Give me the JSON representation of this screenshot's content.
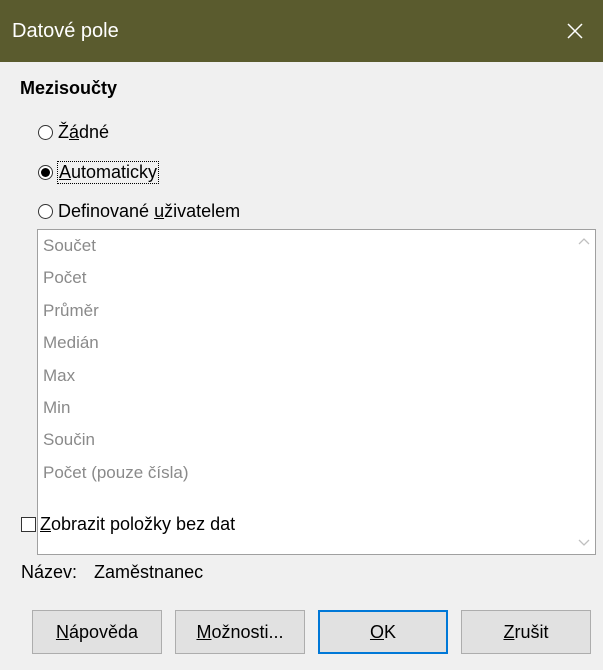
{
  "window": {
    "title": "Datové pole"
  },
  "subtotals": {
    "heading": "Mezisoučty",
    "options": {
      "none": {
        "pre": "Ž",
        "key": "á",
        "post": "dné",
        "selected": false
      },
      "auto": {
        "pre": "",
        "key": "A",
        "post": "utomaticky",
        "selected": true
      },
      "user": {
        "pre": "Definované ",
        "key": "u",
        "post": "živatelem",
        "selected": false
      }
    },
    "functions": [
      "Součet",
      "Počet",
      "Průměr",
      "Medián",
      "Max",
      "Min",
      "Součin",
      "Počet (pouze čísla)"
    ]
  },
  "show_empty": {
    "pre": "",
    "key": "Z",
    "post": "obrazit položky bez dat",
    "checked": false
  },
  "name": {
    "label": "Název:",
    "value": "Zaměstnanec"
  },
  "buttons": {
    "help": {
      "key": "N",
      "post": "ápověda"
    },
    "options": {
      "pre": "",
      "key": "M",
      "post": "ožnosti..."
    },
    "ok": {
      "key": "O",
      "post": "K"
    },
    "cancel": {
      "key": "Z",
      "post": "rušit"
    }
  },
  "colors": {
    "titlebar": "#5a5b2e",
    "background": "#f0f0f0",
    "default_button_border": "#0078d7",
    "disabled_text": "#8a8a8a"
  }
}
